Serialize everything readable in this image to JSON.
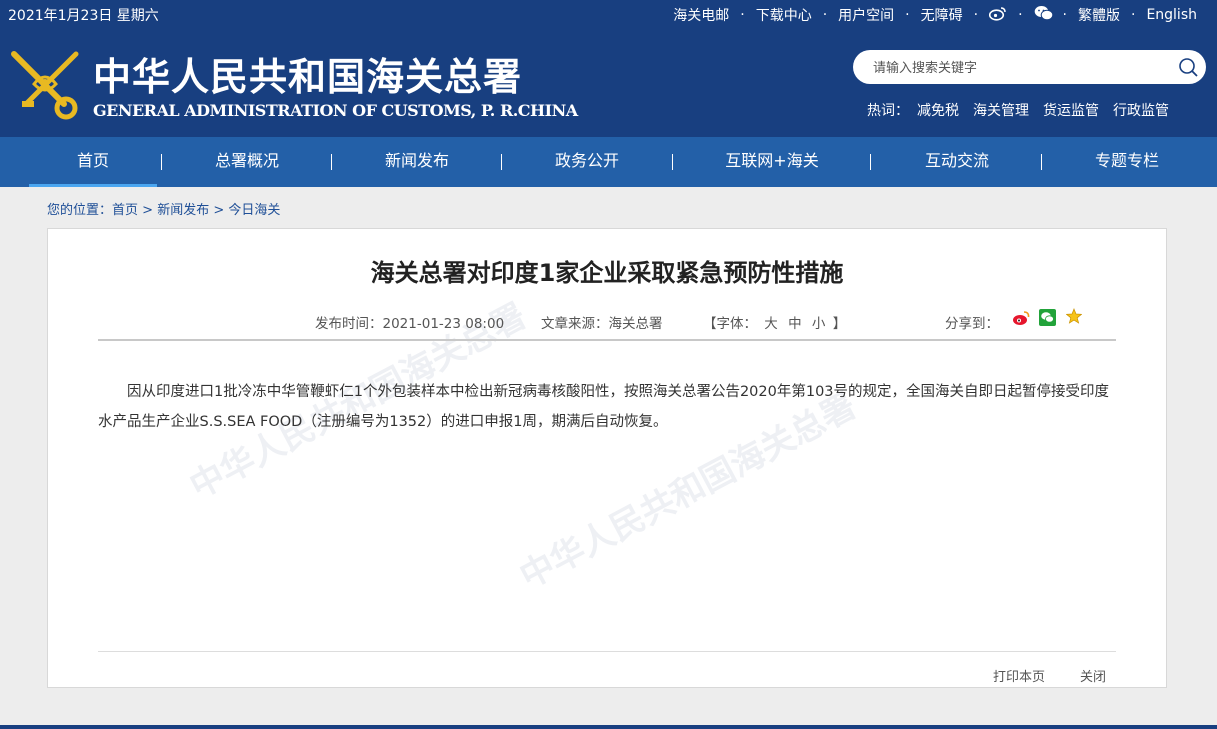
{
  "header": {
    "date": "2021年1月23日 星期六",
    "links": {
      "mail": "海关电邮",
      "download": "下载中心",
      "user": "用户空间",
      "accessible": "无障碍",
      "traditional": "繁體版",
      "english": "English"
    },
    "title": "中华人民共和国海关总署",
    "subtitle": "GENERAL ADMINISTRATION OF CUSTOMS, P. R.CHINA",
    "search_placeholder": "请输入搜索关键字",
    "hot_label": "热词：",
    "hot": [
      "减免税",
      "海关管理",
      "货运监管",
      "行政监管"
    ]
  },
  "nav": [
    "首页",
    "总署概况",
    "新闻发布",
    "政务公开",
    "互联网+海关",
    "互动交流",
    "专题专栏"
  ],
  "breadcrumb": {
    "prefix": "您的位置：",
    "items": [
      "首页",
      "新闻发布",
      "今日海关"
    ],
    "sep": " > "
  },
  "article": {
    "title": "海关总署对印度1家企业采取紧急预防性措施",
    "publish_label": "发布时间：",
    "publish_time": "2021-01-23 08:00",
    "source_label": "文章来源：",
    "source": "海关总署",
    "font_open": "【字体：",
    "font_large": "大",
    "font_medium": "中",
    "font_small": "小",
    "font_close": "】",
    "share_label": "分享到：",
    "body": "因从印度进口1批冷冻中华管鞭虾仁1个外包装样本中检出新冠病毒核酸阳性，按照海关总署公告2020年第103号的规定，全国海关自即日起暂停接受印度水产品生产企业S.S.SEA FOOD（注册编号为1352）的进口申报1周，期满后自动恢复。",
    "print": "打印本页",
    "close": "关闭"
  },
  "colors": {
    "header_bg": "#183f80",
    "nav_bg": "#2360a8",
    "nav_active_underline": "#4ba6f0",
    "link": "#1f4f97"
  },
  "icons": [
    "weibo-icon",
    "wechat-icon",
    "search-icon",
    "customs-emblem-logo",
    "favorite-star-icon"
  ]
}
